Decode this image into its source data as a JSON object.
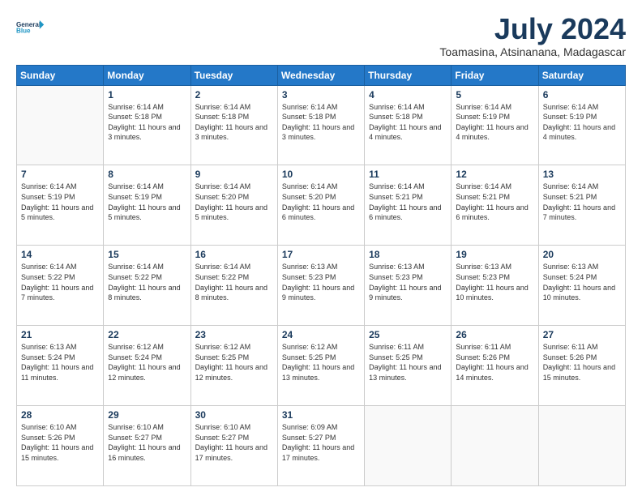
{
  "logo": {
    "line1": "General",
    "line2": "Blue"
  },
  "header": {
    "month": "July 2024",
    "location": "Toamasina, Atsinanana, Madagascar"
  },
  "weekdays": [
    "Sunday",
    "Monday",
    "Tuesday",
    "Wednesday",
    "Thursday",
    "Friday",
    "Saturday"
  ],
  "weeks": [
    [
      {
        "day": "",
        "sunrise": "",
        "sunset": "",
        "daylight": ""
      },
      {
        "day": "1",
        "sunrise": "Sunrise: 6:14 AM",
        "sunset": "Sunset: 5:18 PM",
        "daylight": "Daylight: 11 hours and 3 minutes."
      },
      {
        "day": "2",
        "sunrise": "Sunrise: 6:14 AM",
        "sunset": "Sunset: 5:18 PM",
        "daylight": "Daylight: 11 hours and 3 minutes."
      },
      {
        "day": "3",
        "sunrise": "Sunrise: 6:14 AM",
        "sunset": "Sunset: 5:18 PM",
        "daylight": "Daylight: 11 hours and 3 minutes."
      },
      {
        "day": "4",
        "sunrise": "Sunrise: 6:14 AM",
        "sunset": "Sunset: 5:18 PM",
        "daylight": "Daylight: 11 hours and 4 minutes."
      },
      {
        "day": "5",
        "sunrise": "Sunrise: 6:14 AM",
        "sunset": "Sunset: 5:19 PM",
        "daylight": "Daylight: 11 hours and 4 minutes."
      },
      {
        "day": "6",
        "sunrise": "Sunrise: 6:14 AM",
        "sunset": "Sunset: 5:19 PM",
        "daylight": "Daylight: 11 hours and 4 minutes."
      }
    ],
    [
      {
        "day": "7",
        "sunrise": "Sunrise: 6:14 AM",
        "sunset": "Sunset: 5:19 PM",
        "daylight": "Daylight: 11 hours and 5 minutes."
      },
      {
        "day": "8",
        "sunrise": "Sunrise: 6:14 AM",
        "sunset": "Sunset: 5:19 PM",
        "daylight": "Daylight: 11 hours and 5 minutes."
      },
      {
        "day": "9",
        "sunrise": "Sunrise: 6:14 AM",
        "sunset": "Sunset: 5:20 PM",
        "daylight": "Daylight: 11 hours and 5 minutes."
      },
      {
        "day": "10",
        "sunrise": "Sunrise: 6:14 AM",
        "sunset": "Sunset: 5:20 PM",
        "daylight": "Daylight: 11 hours and 6 minutes."
      },
      {
        "day": "11",
        "sunrise": "Sunrise: 6:14 AM",
        "sunset": "Sunset: 5:21 PM",
        "daylight": "Daylight: 11 hours and 6 minutes."
      },
      {
        "day": "12",
        "sunrise": "Sunrise: 6:14 AM",
        "sunset": "Sunset: 5:21 PM",
        "daylight": "Daylight: 11 hours and 6 minutes."
      },
      {
        "day": "13",
        "sunrise": "Sunrise: 6:14 AM",
        "sunset": "Sunset: 5:21 PM",
        "daylight": "Daylight: 11 hours and 7 minutes."
      }
    ],
    [
      {
        "day": "14",
        "sunrise": "Sunrise: 6:14 AM",
        "sunset": "Sunset: 5:22 PM",
        "daylight": "Daylight: 11 hours and 7 minutes."
      },
      {
        "day": "15",
        "sunrise": "Sunrise: 6:14 AM",
        "sunset": "Sunset: 5:22 PM",
        "daylight": "Daylight: 11 hours and 8 minutes."
      },
      {
        "day": "16",
        "sunrise": "Sunrise: 6:14 AM",
        "sunset": "Sunset: 5:22 PM",
        "daylight": "Daylight: 11 hours and 8 minutes."
      },
      {
        "day": "17",
        "sunrise": "Sunrise: 6:13 AM",
        "sunset": "Sunset: 5:23 PM",
        "daylight": "Daylight: 11 hours and 9 minutes."
      },
      {
        "day": "18",
        "sunrise": "Sunrise: 6:13 AM",
        "sunset": "Sunset: 5:23 PM",
        "daylight": "Daylight: 11 hours and 9 minutes."
      },
      {
        "day": "19",
        "sunrise": "Sunrise: 6:13 AM",
        "sunset": "Sunset: 5:23 PM",
        "daylight": "Daylight: 11 hours and 10 minutes."
      },
      {
        "day": "20",
        "sunrise": "Sunrise: 6:13 AM",
        "sunset": "Sunset: 5:24 PM",
        "daylight": "Daylight: 11 hours and 10 minutes."
      }
    ],
    [
      {
        "day": "21",
        "sunrise": "Sunrise: 6:13 AM",
        "sunset": "Sunset: 5:24 PM",
        "daylight": "Daylight: 11 hours and 11 minutes."
      },
      {
        "day": "22",
        "sunrise": "Sunrise: 6:12 AM",
        "sunset": "Sunset: 5:24 PM",
        "daylight": "Daylight: 11 hours and 12 minutes."
      },
      {
        "day": "23",
        "sunrise": "Sunrise: 6:12 AM",
        "sunset": "Sunset: 5:25 PM",
        "daylight": "Daylight: 11 hours and 12 minutes."
      },
      {
        "day": "24",
        "sunrise": "Sunrise: 6:12 AM",
        "sunset": "Sunset: 5:25 PM",
        "daylight": "Daylight: 11 hours and 13 minutes."
      },
      {
        "day": "25",
        "sunrise": "Sunrise: 6:11 AM",
        "sunset": "Sunset: 5:25 PM",
        "daylight": "Daylight: 11 hours and 13 minutes."
      },
      {
        "day": "26",
        "sunrise": "Sunrise: 6:11 AM",
        "sunset": "Sunset: 5:26 PM",
        "daylight": "Daylight: 11 hours and 14 minutes."
      },
      {
        "day": "27",
        "sunrise": "Sunrise: 6:11 AM",
        "sunset": "Sunset: 5:26 PM",
        "daylight": "Daylight: 11 hours and 15 minutes."
      }
    ],
    [
      {
        "day": "28",
        "sunrise": "Sunrise: 6:10 AM",
        "sunset": "Sunset: 5:26 PM",
        "daylight": "Daylight: 11 hours and 15 minutes."
      },
      {
        "day": "29",
        "sunrise": "Sunrise: 6:10 AM",
        "sunset": "Sunset: 5:27 PM",
        "daylight": "Daylight: 11 hours and 16 minutes."
      },
      {
        "day": "30",
        "sunrise": "Sunrise: 6:10 AM",
        "sunset": "Sunset: 5:27 PM",
        "daylight": "Daylight: 11 hours and 17 minutes."
      },
      {
        "day": "31",
        "sunrise": "Sunrise: 6:09 AM",
        "sunset": "Sunset: 5:27 PM",
        "daylight": "Daylight: 11 hours and 17 minutes."
      },
      {
        "day": "",
        "sunrise": "",
        "sunset": "",
        "daylight": ""
      },
      {
        "day": "",
        "sunrise": "",
        "sunset": "",
        "daylight": ""
      },
      {
        "day": "",
        "sunrise": "",
        "sunset": "",
        "daylight": ""
      }
    ]
  ]
}
